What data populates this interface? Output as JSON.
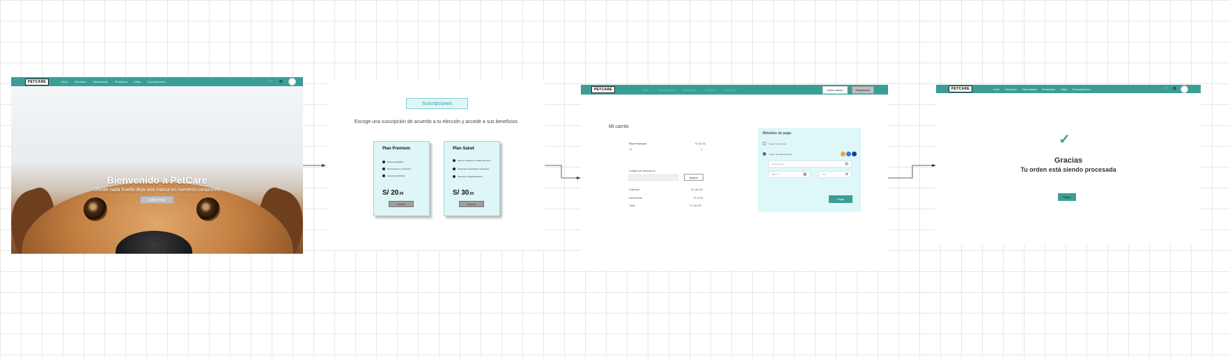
{
  "colors": {
    "brand_teal": "#3a9e97",
    "panel_cyan": "#def6f7",
    "link_blue": "#3a6ea5"
  },
  "landing": {
    "logo": "PETCARE",
    "nav": [
      "Inicio",
      "Servicios",
      "Veterinarias",
      "Productos",
      "Citas",
      "Suscripciones"
    ],
    "icons": [
      "cart-icon",
      "settings-icon",
      "avatar"
    ],
    "hero_title": "Bienvenido a PetCare",
    "hero_subtitle": "Donde cada huella deja una marca en nuestros corazones",
    "hero_button": "Saber más"
  },
  "subscriptions": {
    "title": "Suscripciones",
    "lead": "Escoge una suscripción de acuerdo a tu elección y accede a sus beneficios",
    "plans": [
      {
        "name": "Plan Premium",
        "features": [
          "Paseos ilimitados",
          "Descuentos en productos",
          "Atención prioritaria"
        ],
        "price_main": "S/ 20",
        "price_cents": ".00",
        "button": "Empezar"
      },
      {
        "name": "Plan Salud",
        "features": [
          "Todo lo incluido en el Plan Premium",
          "Chequeos veterinarios mensuales",
          "Vacunas y desparasitación"
        ],
        "price_main": "S/ 30",
        "price_cents": ".00",
        "button": "Empezar"
      }
    ]
  },
  "cart": {
    "logo": "PETCARE",
    "nav": [
      "Inicio",
      "Suscripciones",
      "Beneficios",
      "Contacto",
      "Nosotros"
    ],
    "login": "Iniciar sesión",
    "register": "Registrarse",
    "title": "Mi carrito",
    "item_name": "Plan Premium",
    "item_price": "S/ 20.00",
    "qty": "x1",
    "qty_right": "1",
    "discount_label": "Código de descuento",
    "apply": "Aplicar",
    "subtotal_label": "Subtotal",
    "subtotal_value": "S/ 160.00",
    "discount_row_label": "Descuento",
    "discount_row_value": "S/ 0.00",
    "total_label": "Total",
    "total_value": "S/ 160.00",
    "payment": {
      "title": "Métodos de pago",
      "option_cash": "Pagar con efectivo",
      "option_card": "Tarjeta de débito/Crédito",
      "card_number": "Card number",
      "expiry": "MM / YY",
      "cvv": "CVV",
      "pay": "Pagar"
    }
  },
  "thanks": {
    "logo": "PETCARE",
    "nav": [
      "Inicio",
      "Servicios",
      "Veterinarias",
      "Productos",
      "Citas",
      "Suscripciones"
    ],
    "title": "Gracias",
    "subtitle": "Tu orden está siendo procesada",
    "button": "Volver"
  }
}
